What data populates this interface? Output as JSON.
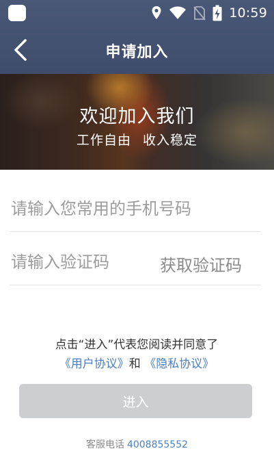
{
  "status_bar": {
    "time": "10:59",
    "icons": [
      "app-icon",
      "location-icon",
      "wifi-icon",
      "no-sim-icon",
      "battery-charging-icon"
    ]
  },
  "nav": {
    "title": "申请加入",
    "back_icon": "chevron-left-icon"
  },
  "banner": {
    "title": "欢迎加入我们",
    "subtitle": "工作自由 收入稳定"
  },
  "form": {
    "phone_placeholder": "请输入您常用的手机号码",
    "code_placeholder": "请输入验证码",
    "get_code_label": "获取验证码"
  },
  "agreement": {
    "prefix": "点击“进入”代表您阅读并同意了",
    "user_agreement": "《用户协议》",
    "conjunction": "和",
    "privacy_policy": "《隐私协议》"
  },
  "submit": {
    "label": "进入"
  },
  "service": {
    "label": "客服电话",
    "phone": "4008855552"
  },
  "colors": {
    "header_bg": "#44516f",
    "link": "#4a7fc1",
    "button_disabled": "#cdced2"
  }
}
